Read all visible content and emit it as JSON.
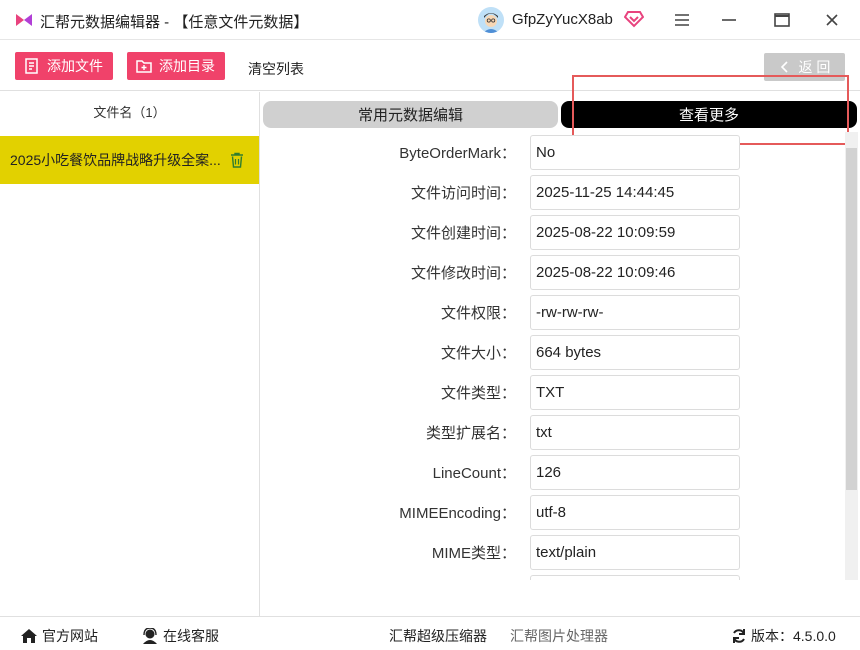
{
  "window": {
    "title": "汇帮元数据编辑器 - 【任意文件元数据】",
    "username": "GfpZyYucX8ab"
  },
  "toolbar": {
    "add_file": "添加文件",
    "add_dir": "添加目录",
    "clear_list": "清空列表",
    "back": "返 回"
  },
  "file_list": {
    "header": "文件名（1）",
    "items": [
      {
        "name": "2025小吃餐饮品牌战略升级全案..."
      }
    ]
  },
  "tabs": {
    "common": "常用元数据编辑",
    "more": "查看更多"
  },
  "metadata": [
    {
      "label": "ByteOrderMark：",
      "value": "No"
    },
    {
      "label": "文件访问时间：",
      "value": "2025-11-25 14:44:45"
    },
    {
      "label": "文件创建时间：",
      "value": "2025-08-22 10:09:59"
    },
    {
      "label": "文件修改时间：",
      "value": "2025-08-22 10:09:46"
    },
    {
      "label": "文件权限：",
      "value": "-rw-rw-rw-"
    },
    {
      "label": "文件大小：",
      "value": "664 bytes"
    },
    {
      "label": "文件类型：",
      "value": "TXT"
    },
    {
      "label": "类型扩展名：",
      "value": "txt"
    },
    {
      "label": "LineCount：",
      "value": "126"
    },
    {
      "label": "MIMEEncoding：",
      "value": "utf-8"
    },
    {
      "label": "MIME类型：",
      "value": "text/plain"
    },
    {
      "label": "",
      "value": ""
    }
  ],
  "statusbar": {
    "website": "官方网站",
    "support": "在线客服",
    "compressor": "汇帮超级压缩器",
    "image_tool": "汇帮图片处理器",
    "version_label": "版本：",
    "version": "4.5.0.0"
  },
  "colors": {
    "accent_pink": "#f0426a",
    "selected_row": "#e2d100",
    "highlight_frame": "#e55a5a"
  }
}
